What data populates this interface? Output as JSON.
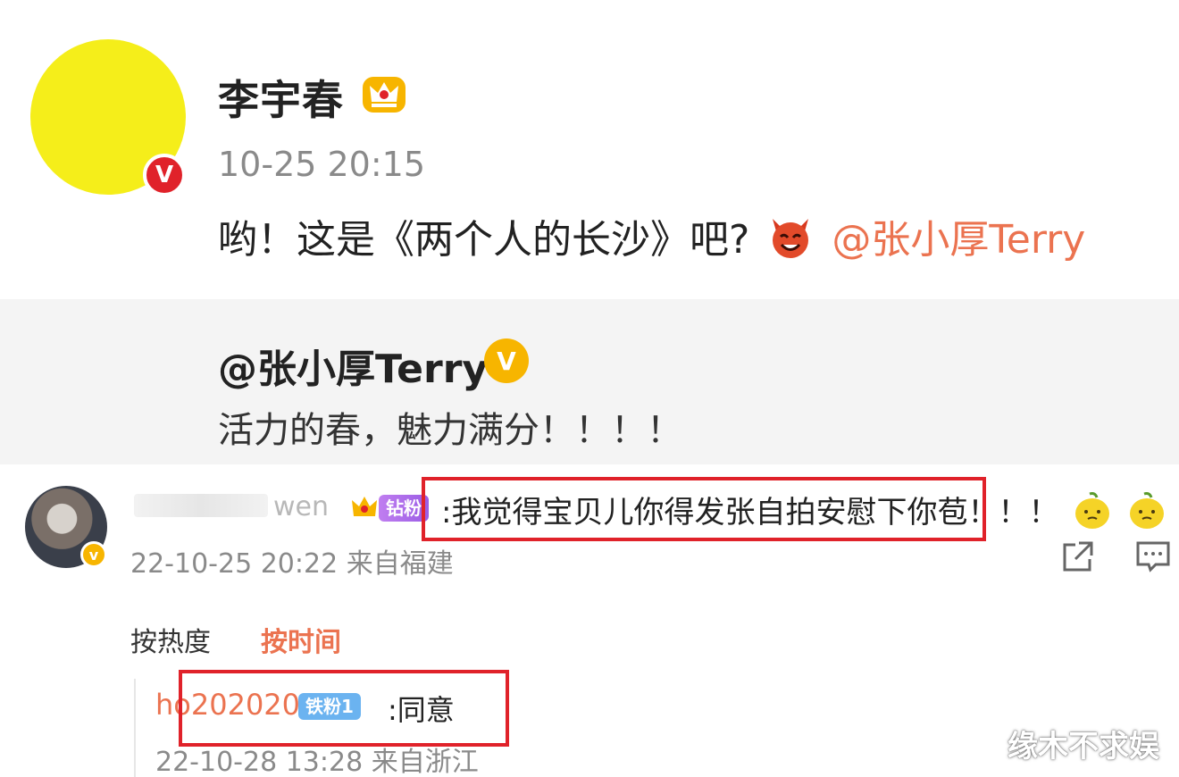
{
  "post": {
    "author": "李宇春",
    "time": "10-25 20:15",
    "text_before": "哟！这是《两个人的长沙》吧?",
    "mention": "@张小厚Terry"
  },
  "repost": {
    "author": "@张小厚Terry",
    "text": "活力的春，魅力满分！！！！"
  },
  "comment": {
    "username_visible": "wen",
    "fan_badge": "钻粉",
    "text": ":我觉得宝贝儿你得发张自拍安慰下你苞！！！",
    "time": "22-10-25 20:22 来自福建"
  },
  "sort": {
    "hot": "按热度",
    "time": "按时间"
  },
  "reply": {
    "user": "ho202020",
    "badge": "铁粉1",
    "text": ":同意",
    "time": "22-10-28 13:28 来自浙江"
  },
  "watermark": "缘木不求娱",
  "colors": {
    "accent": "#eb7350",
    "highlight_box": "#e0222a",
    "verified_red": "#e0222a",
    "verified_gold": "#f7b500"
  }
}
